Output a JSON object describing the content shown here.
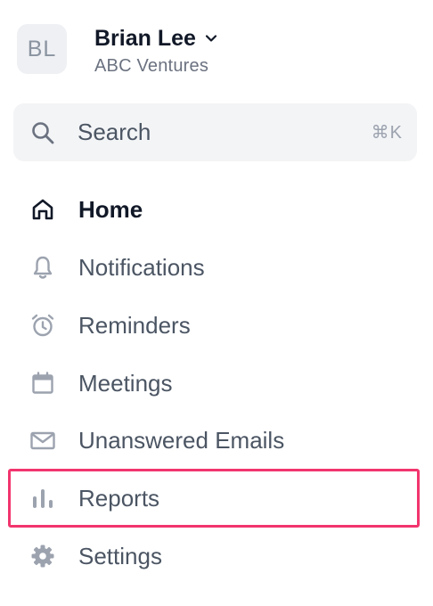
{
  "account": {
    "initials": "BL",
    "name": "Brian Lee",
    "organization": "ABC Ventures"
  },
  "search": {
    "placeholder": "Search",
    "shortcut": "⌘K"
  },
  "nav": {
    "items": [
      {
        "label": "Home",
        "icon": "home-icon",
        "active": true
      },
      {
        "label": "Notifications",
        "icon": "bell-icon"
      },
      {
        "label": "Reminders",
        "icon": "alarm-clock-icon"
      },
      {
        "label": "Meetings",
        "icon": "calendar-icon"
      },
      {
        "label": "Unanswered Emails",
        "icon": "mail-icon"
      },
      {
        "label": "Reports",
        "icon": "bar-chart-icon",
        "highlighted": true
      },
      {
        "label": "Settings",
        "icon": "gear-icon"
      }
    ]
  },
  "colors": {
    "highlight": "#f2356e",
    "text_primary": "#111827",
    "text_secondary": "#4b5563",
    "search_bg": "#f3f4f6",
    "icon": "#9ca3af"
  }
}
